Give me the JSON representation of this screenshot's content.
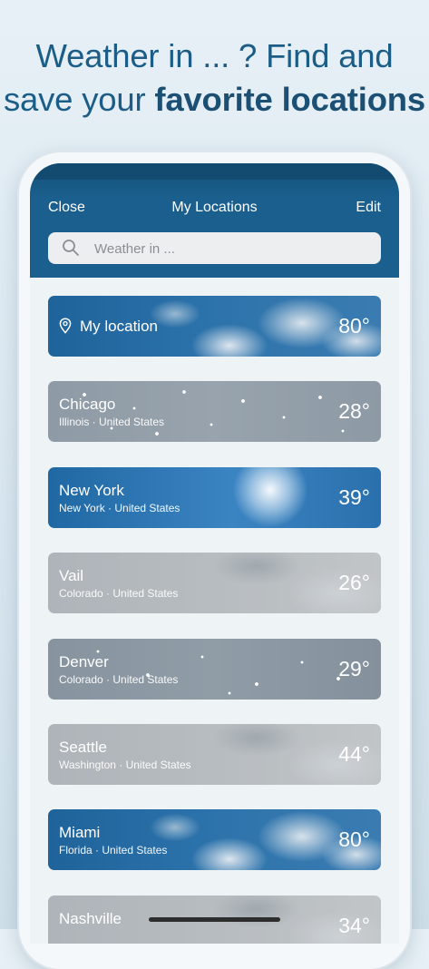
{
  "promo": {
    "line1": "Weather in ... ? Find and",
    "line2_prefix": "save your ",
    "line2_bold": "favorite locations"
  },
  "nav": {
    "close_label": "Close",
    "title": "My Locations",
    "edit_label": "Edit"
  },
  "search": {
    "placeholder": "Weather in ...",
    "icon": "search-icon"
  },
  "locations": [
    {
      "name": "My location",
      "subtitle": "",
      "temp": "80°",
      "style": "blue-cloud",
      "icon": "location-pin-icon"
    },
    {
      "name": "Chicago",
      "subtitle": "Illinois · United States",
      "temp": "28°",
      "style": "snow"
    },
    {
      "name": "New York",
      "subtitle": "New York · United States",
      "temp": "39°",
      "style": "sunny"
    },
    {
      "name": "Vail",
      "subtitle": "Colorado · United States",
      "temp": "26°",
      "style": "cloudy"
    },
    {
      "name": "Denver",
      "subtitle": "Colorado · United States",
      "temp": "29°",
      "style": "grey-snow"
    },
    {
      "name": "Seattle",
      "subtitle": "Washington · United States",
      "temp": "44°",
      "style": "cloudy"
    },
    {
      "name": "Miami",
      "subtitle": "Florida · United States",
      "temp": "80°",
      "style": "blue-cloud"
    },
    {
      "name": "Nashville",
      "subtitle": "",
      "temp": "34°",
      "style": "cloudy"
    }
  ],
  "colors": {
    "headline": "#1b5d86",
    "nav_bar": "#1a5f8d"
  }
}
